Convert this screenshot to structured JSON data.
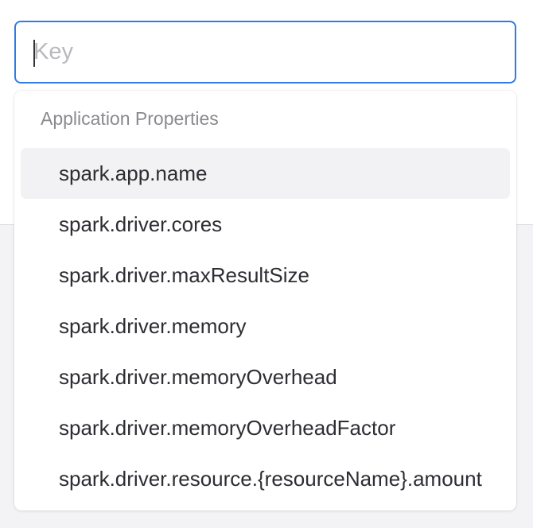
{
  "search": {
    "placeholder": "Key",
    "value": ""
  },
  "dropdown": {
    "group_label": "Application Properties",
    "highlighted_index": 0,
    "options": [
      "spark.app.name",
      "spark.driver.cores",
      "spark.driver.maxResultSize",
      "spark.driver.memory",
      "spark.driver.memoryOverhead",
      "spark.driver.memoryOverheadFactor",
      "spark.driver.resource.{resourceName}.amount"
    ]
  },
  "colors": {
    "focus_border": "#2f7ce8",
    "highlight_bg": "#f2f2f4",
    "group_label": "#8a8a8f",
    "option_text": "#2d2d33",
    "placeholder": "#b9b9bd"
  }
}
